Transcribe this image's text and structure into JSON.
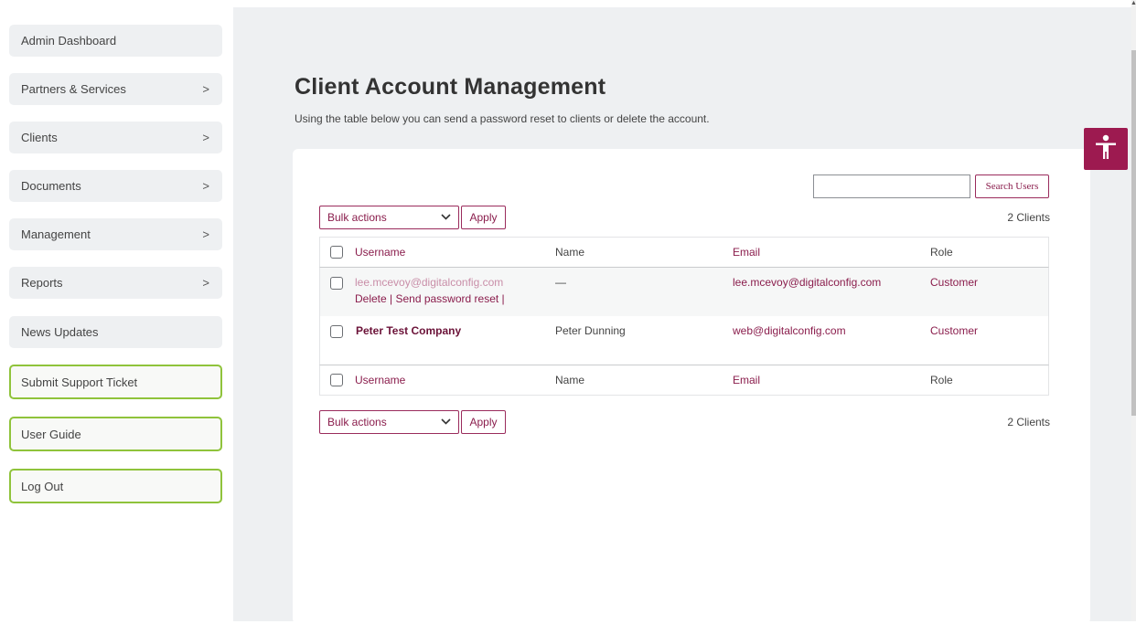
{
  "sidebar": {
    "items": [
      {
        "label": "Admin Dashboard",
        "chevron": ""
      },
      {
        "label": "Partners & Services",
        "chevron": ">"
      },
      {
        "label": "Clients",
        "chevron": ">"
      },
      {
        "label": "Documents",
        "chevron": ">"
      },
      {
        "label": "Management",
        "chevron": ">"
      },
      {
        "label": "Reports",
        "chevron": ">"
      },
      {
        "label": "News Updates",
        "chevron": ""
      }
    ],
    "outlined_items": [
      {
        "label": "Submit Support Ticket"
      },
      {
        "label": "User Guide"
      },
      {
        "label": "Log Out"
      }
    ]
  },
  "page": {
    "title": "Client Account Management",
    "description": "Using the table below you can send a password reset to clients or delete the account."
  },
  "search": {
    "value": "",
    "button_label": "Search Users"
  },
  "bulk": {
    "select_label": "Bulk actions",
    "apply_label": "Apply",
    "count_text": "2 Clients"
  },
  "table": {
    "columns": [
      "Username",
      "Name",
      "Email",
      "Role"
    ],
    "rows": [
      {
        "username": "lee.mcevoy@digitalconfig.com",
        "row_actions": "Delete | Send password reset |",
        "name": "—",
        "email": "lee.mcevoy@digitalconfig.com",
        "role": "Customer"
      },
      {
        "username": "Peter Test Company",
        "name": "Peter Dunning",
        "email": "web@digitalconfig.com",
        "role": "Customer"
      }
    ]
  },
  "colors": {
    "accent": "#9a2b5c",
    "accessibility_button": "#9d1a50",
    "outline_green": "#8fc33b",
    "main_bg": "#eef0f2"
  },
  "icons": {
    "accessibility": "accessibility-person-icon",
    "chevron": "chevron-right-icon",
    "select_caret": "chevron-down-icon"
  }
}
